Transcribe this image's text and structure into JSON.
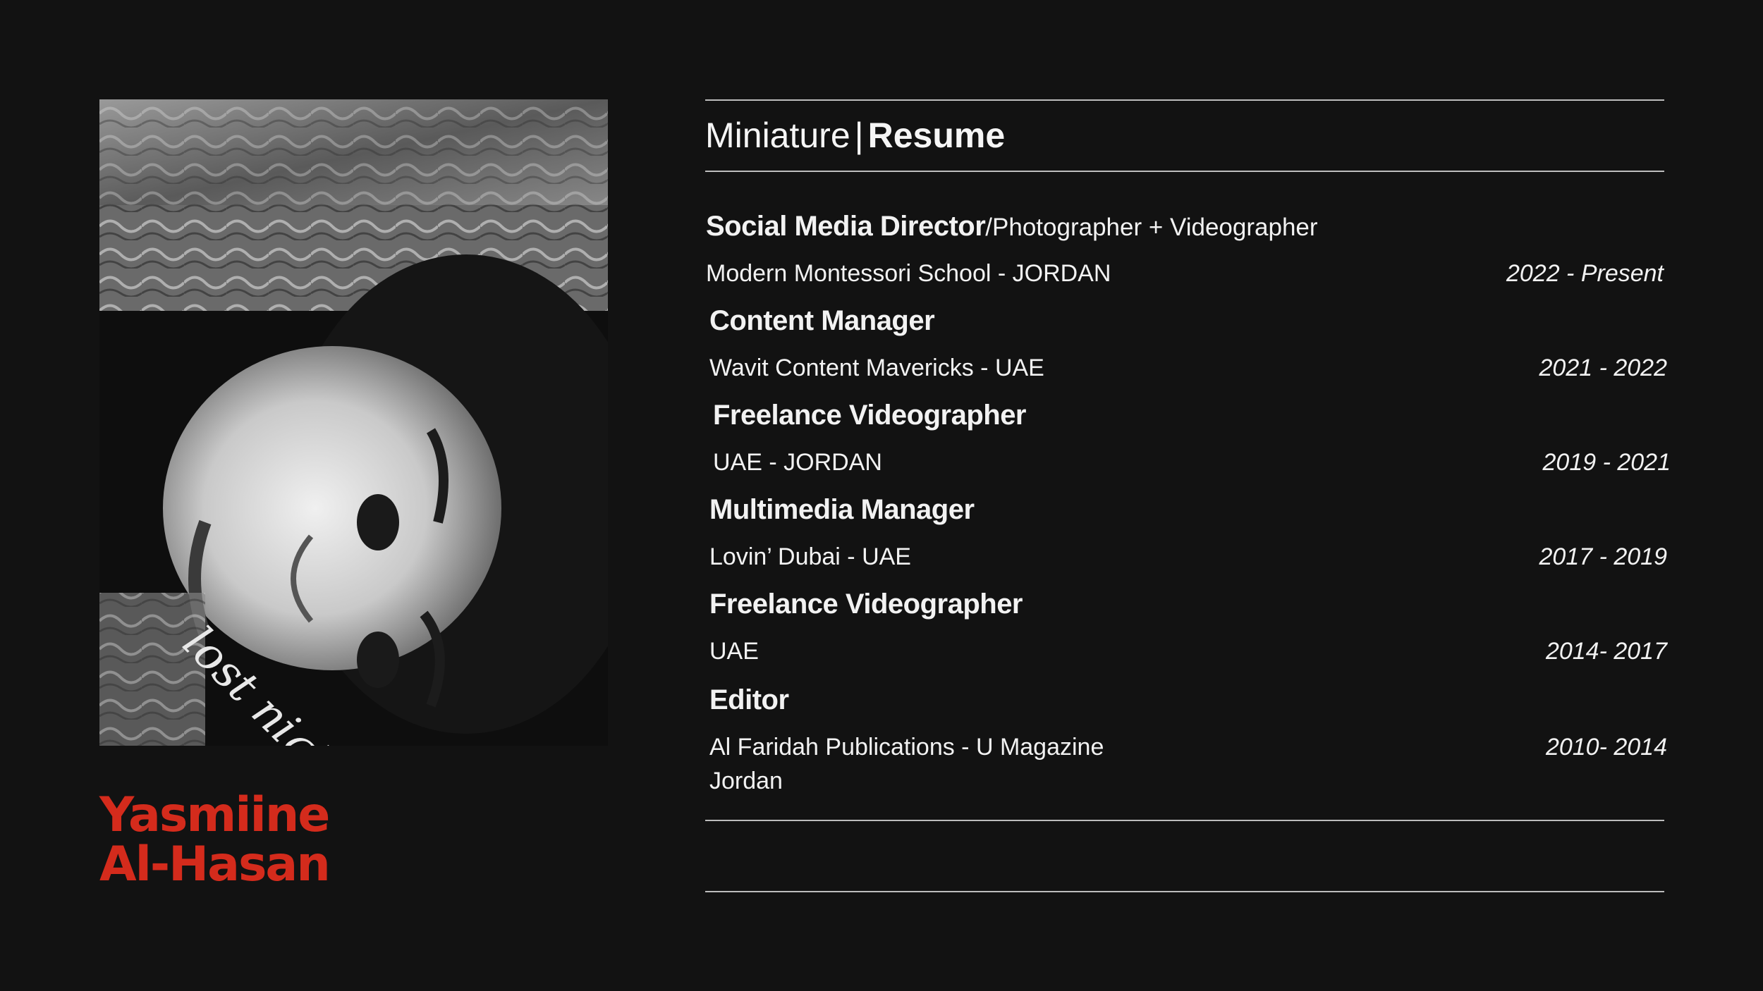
{
  "theme": {
    "background": "#121212",
    "accent": "#d42b1c",
    "text": "#f2f2f2",
    "rule": "#bdbdbd"
  },
  "photo": {
    "alt": "Black and white portrait",
    "overlay_text": "lost night"
  },
  "person": {
    "first_name": "Yasmiine",
    "last_name": "Al-Hasan"
  },
  "heading": {
    "light": "Miniature",
    "separator": "|",
    "bold": "Resume"
  },
  "jobs": [
    {
      "title": "Social Media Director",
      "role_extra": "/Photographer + Videographer",
      "org": "Modern Montessori School  - JORDAN",
      "org_extra": "",
      "dates": "2022 - Present"
    },
    {
      "title": "Content Manager",
      "role_extra": "",
      "org": "Wavit Content Mavericks - UAE",
      "org_extra": "",
      "dates": "2021 - 2022"
    },
    {
      "title": "Freelance Videographer",
      "role_extra": "",
      "org": "UAE - JORDAN",
      "org_extra": "",
      "dates": "2019 - 2021"
    },
    {
      "title": "Multimedia Manager",
      "role_extra": "",
      "org": "Lovin’ Dubai - UAE",
      "org_extra": "",
      "dates": "2017 - 2019"
    },
    {
      "title": "Freelance Videographer",
      "role_extra": "",
      "org": "UAE",
      "org_extra": "",
      "dates": "2014- 2017"
    },
    {
      "title": "Editor",
      "role_extra": "",
      "org": "Al Faridah Publications - U Magazine",
      "org_extra": "Jordan",
      "dates": "2010- 2014"
    }
  ]
}
